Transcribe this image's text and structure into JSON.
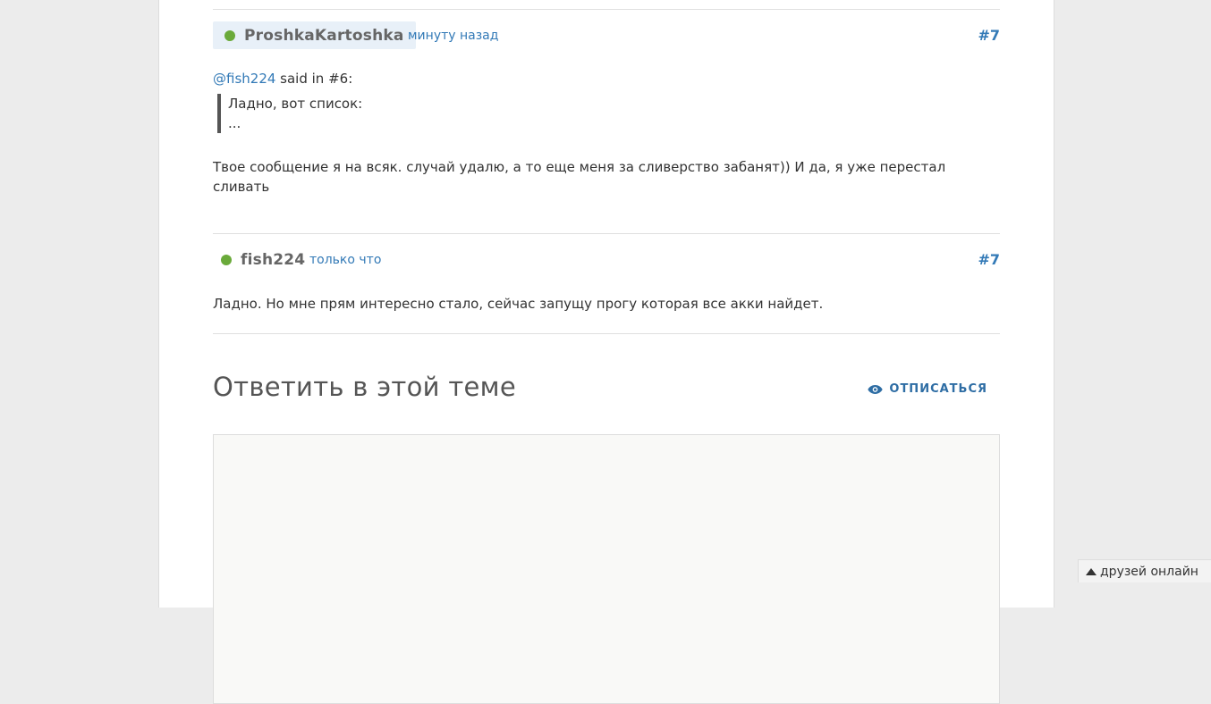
{
  "posts": [
    {
      "author": "ProshkaKartoshka",
      "time": "минуту назад",
      "number": "#7",
      "mention": "@fish224",
      "said_in": " said in #6:",
      "quote_lines": [
        "Ладно, вот список:",
        "..."
      ],
      "text": "Твое сообщение я на всяк. случай удалю, а то еще меня за сливерство забанят)) И да, я уже перестал сливать"
    },
    {
      "author": "fish224",
      "time": "только что",
      "number": "#7",
      "text": "Ладно. Но мне прям интересно стало, сейчас запущу прогу которая все акки найдет."
    }
  ],
  "reply": {
    "title": "Ответить в этой теме",
    "unsubscribe_label": "ОТПИСАТЬСЯ",
    "unsubscribe_icon": "eye-icon"
  },
  "friends_bar": {
    "label": "друзей онлайн",
    "icon": "triangle-up-icon"
  },
  "colors": {
    "link": "#337ab7",
    "online": "#6aaa3a",
    "author_highlight": "#e8f0f8"
  }
}
